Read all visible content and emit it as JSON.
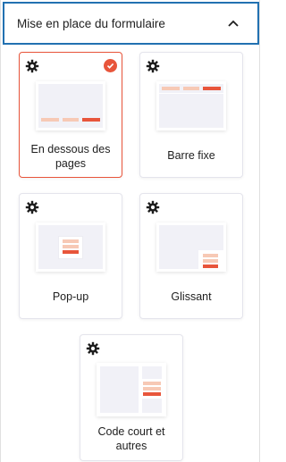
{
  "header": {
    "title": "Mise en place du formulaire"
  },
  "cards": [
    {
      "label": "En dessous des pages",
      "selected": true
    },
    {
      "label": "Barre fixe",
      "selected": false
    },
    {
      "label": "Pop-up",
      "selected": false
    },
    {
      "label": "Glissant",
      "selected": false
    },
    {
      "label": "Code court et autres",
      "selected": false
    }
  ],
  "colors": {
    "accent": "#e8553b",
    "accent_light": "#f7c9b5",
    "focus_border": "#2271b1"
  }
}
